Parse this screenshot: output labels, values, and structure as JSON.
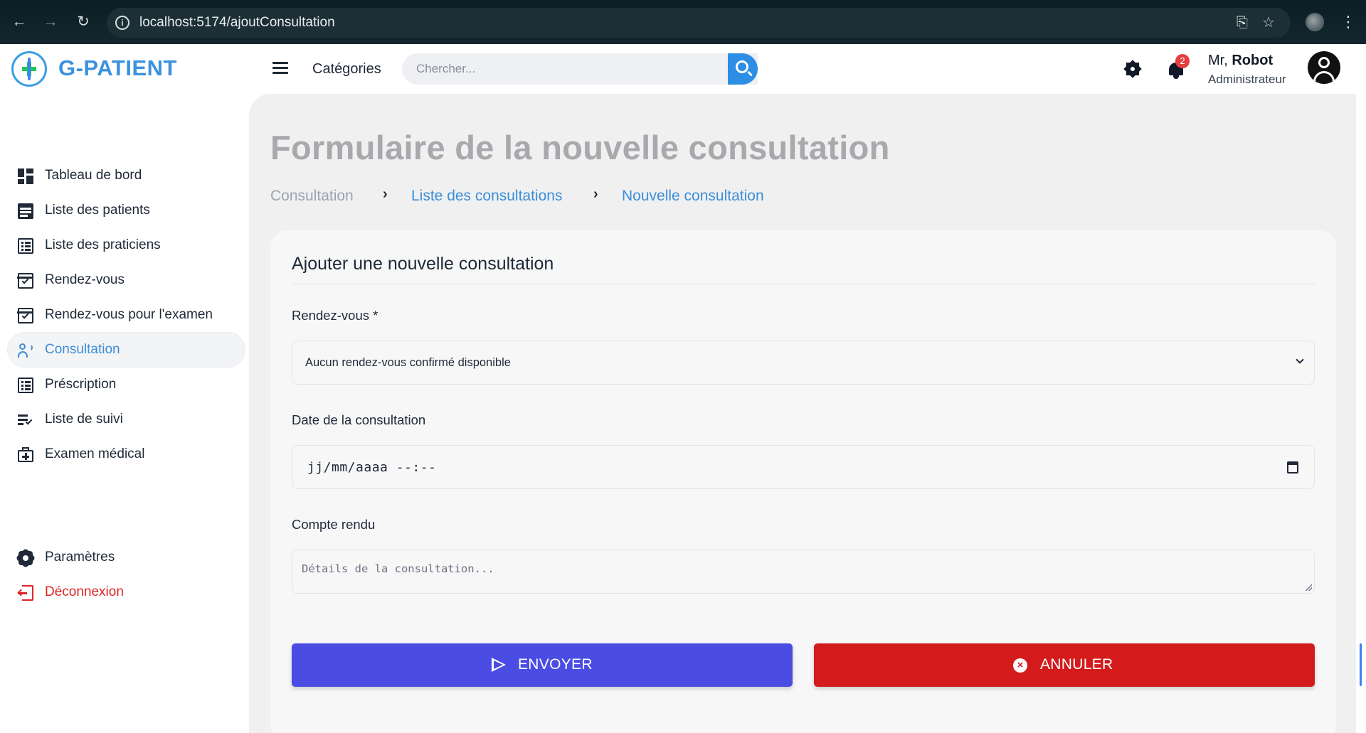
{
  "browser": {
    "url": "localhost:5174/ajoutConsultation"
  },
  "header": {
    "brand": "G-PATIENT",
    "categories_label": "Catégories",
    "search_placeholder": "Chercher...",
    "notification_count": "2",
    "user_prefix": "Mr, ",
    "user_name": "Robot",
    "user_role": "Administrateur"
  },
  "sidebar": {
    "items": [
      {
        "label": "Tableau de bord",
        "icon": "dashboard-icon"
      },
      {
        "label": "Liste des patients",
        "icon": "list-icon"
      },
      {
        "label": "Liste des praticiens",
        "icon": "list-alt-icon"
      },
      {
        "label": "Rendez-vous",
        "icon": "calendar-check-icon"
      },
      {
        "label": "Rendez-vous pour l'examen",
        "icon": "calendar-check-icon"
      },
      {
        "label": "Consultation",
        "icon": "consultation-icon",
        "active": true
      },
      {
        "label": "Préscription",
        "icon": "list-alt-icon"
      },
      {
        "label": "Liste de suivi",
        "icon": "checklist-icon"
      },
      {
        "label": "Examen médical",
        "icon": "medical-bag-icon"
      }
    ],
    "bottom": [
      {
        "label": "Paramètres",
        "icon": "gear-icon"
      },
      {
        "label": "Déconnexion",
        "icon": "logout-icon"
      }
    ]
  },
  "page": {
    "title": "Formulaire de la nouvelle consultation",
    "breadcrumb": [
      "Consultation",
      "Liste des consultations",
      "Nouvelle consultation"
    ]
  },
  "form": {
    "card_title": "Ajouter une nouvelle consultation",
    "rendezvous_label": "Rendez-vous *",
    "rendezvous_value": "Aucun rendez-vous confirmé disponible",
    "date_label": "Date de la consultation",
    "date_value": "jj/mm/aaaa --:--",
    "compte_label": "Compte rendu",
    "compte_placeholder": "Détails de la consultation...",
    "send_label": "ENVOYER",
    "cancel_label": "ANNULER"
  },
  "colors": {
    "accent": "#3b8ed8",
    "send": "#4a4ce3",
    "cancel": "#d31b1b",
    "danger_text": "#dc2626"
  }
}
